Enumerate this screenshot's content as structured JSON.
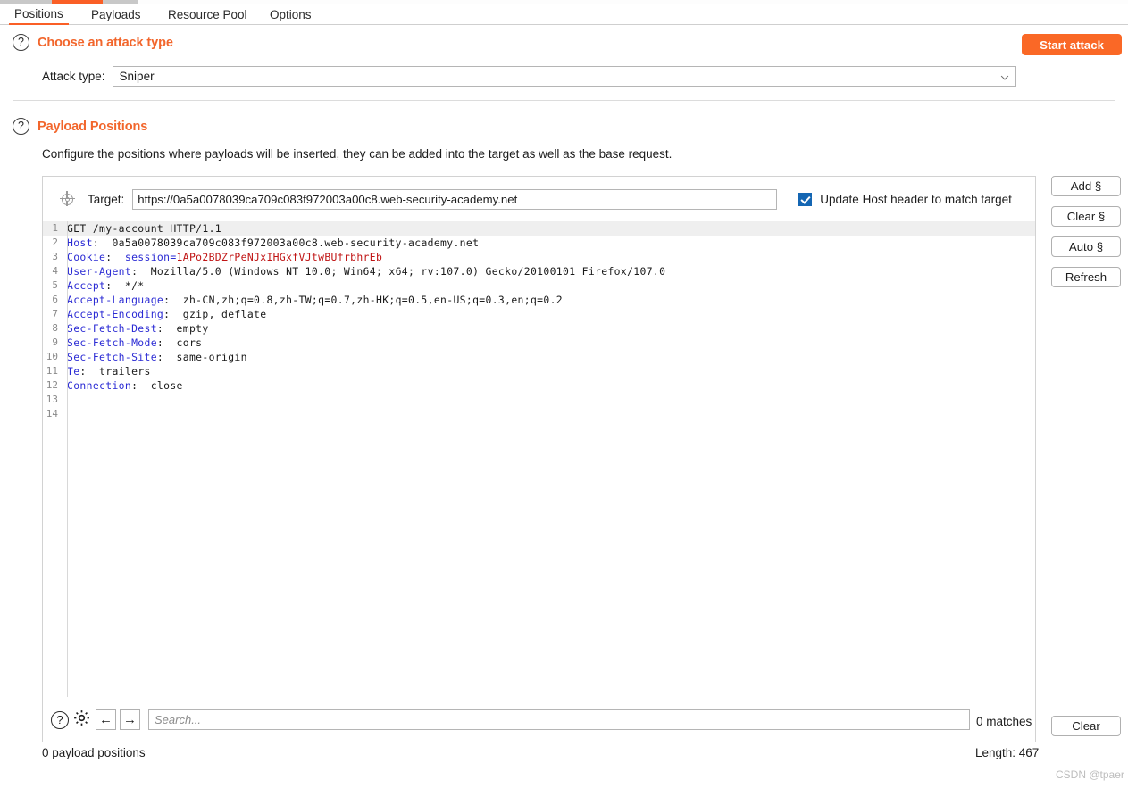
{
  "tabs": [
    {
      "label": "Positions",
      "active": true
    },
    {
      "label": "Payloads",
      "active": false
    },
    {
      "label": "Resource Pool",
      "active": false
    },
    {
      "label": "Options",
      "active": false
    }
  ],
  "toolbar": {
    "start_attack_label": "Start attack",
    "accent_color": "#fa6826"
  },
  "attack_section": {
    "title": "Choose an attack type",
    "help_glyph": "?",
    "attack_type_label": "Attack type:",
    "attack_type_value": "Sniper"
  },
  "payload_section": {
    "title": "Payload Positions",
    "help_glyph": "?",
    "description": "Configure the positions where payloads will be inserted, they can be added into the target as well as the base request."
  },
  "target": {
    "icon": "crosshair-icon",
    "label": "Target:",
    "value": "https://0a5a0078039ca709c083f972003a00c8.web-security-academy.net",
    "update_host_label": "Update Host header to match target",
    "update_host_checked": true
  },
  "side_buttons": [
    {
      "label": "Add §",
      "name": "add-section-button"
    },
    {
      "label": "Clear §",
      "name": "clear-section-button"
    },
    {
      "label": "Auto §",
      "name": "auto-section-button"
    },
    {
      "label": "Refresh",
      "name": "refresh-button"
    }
  ],
  "request": {
    "lines": [
      {
        "n": "1",
        "text": "GET /my-account HTTP/1.1",
        "highlight": true
      },
      {
        "n": "2",
        "header": "Host",
        "text": ":  0a5a0078039ca709c083f972003a00c8.web-security-academy.net"
      },
      {
        "n": "3",
        "header": "Cookie",
        "text": ":  ",
        "cookie_name": "session=",
        "cookie_value": "1APo2BDZrPeNJxIHGxfVJtwBUfrbhrEb"
      },
      {
        "n": "4",
        "header": "User-Agent",
        "text": ":  Mozilla/5.0 (Windows NT 10.0; Win64; x64; rv:107.0) Gecko/20100101 Firefox/107.0"
      },
      {
        "n": "5",
        "header": "Accept",
        "text": ":  */*"
      },
      {
        "n": "6",
        "header": "Accept-Language",
        "text": ":  zh-CN,zh;q=0.8,zh-TW;q=0.7,zh-HK;q=0.5,en-US;q=0.3,en;q=0.2"
      },
      {
        "n": "7",
        "header": "Accept-Encoding",
        "text": ":  gzip, deflate"
      },
      {
        "n": "8",
        "header": "Sec-Fetch-Dest",
        "text": ":  empty"
      },
      {
        "n": "9",
        "header": "Sec-Fetch-Mode",
        "text": ":  cors"
      },
      {
        "n": "10",
        "header": "Sec-Fetch-Site",
        "text": ":  same-origin"
      },
      {
        "n": "11",
        "header": "Te",
        "text": ":  trailers"
      },
      {
        "n": "12",
        "header": "Connection",
        "text": ":  close"
      },
      {
        "n": "13",
        "text": ""
      },
      {
        "n": "14",
        "text": ""
      }
    ]
  },
  "search": {
    "help_glyph": "?",
    "gear_icon": "gear-icon",
    "prev_glyph": "←",
    "next_glyph": "→",
    "placeholder": "Search...",
    "value": "",
    "matches": "0 matches",
    "clear_label": "Clear"
  },
  "status": {
    "payload_positions": "0 payload positions",
    "length": "Length: 467"
  },
  "watermark": "CSDN @tpaer"
}
